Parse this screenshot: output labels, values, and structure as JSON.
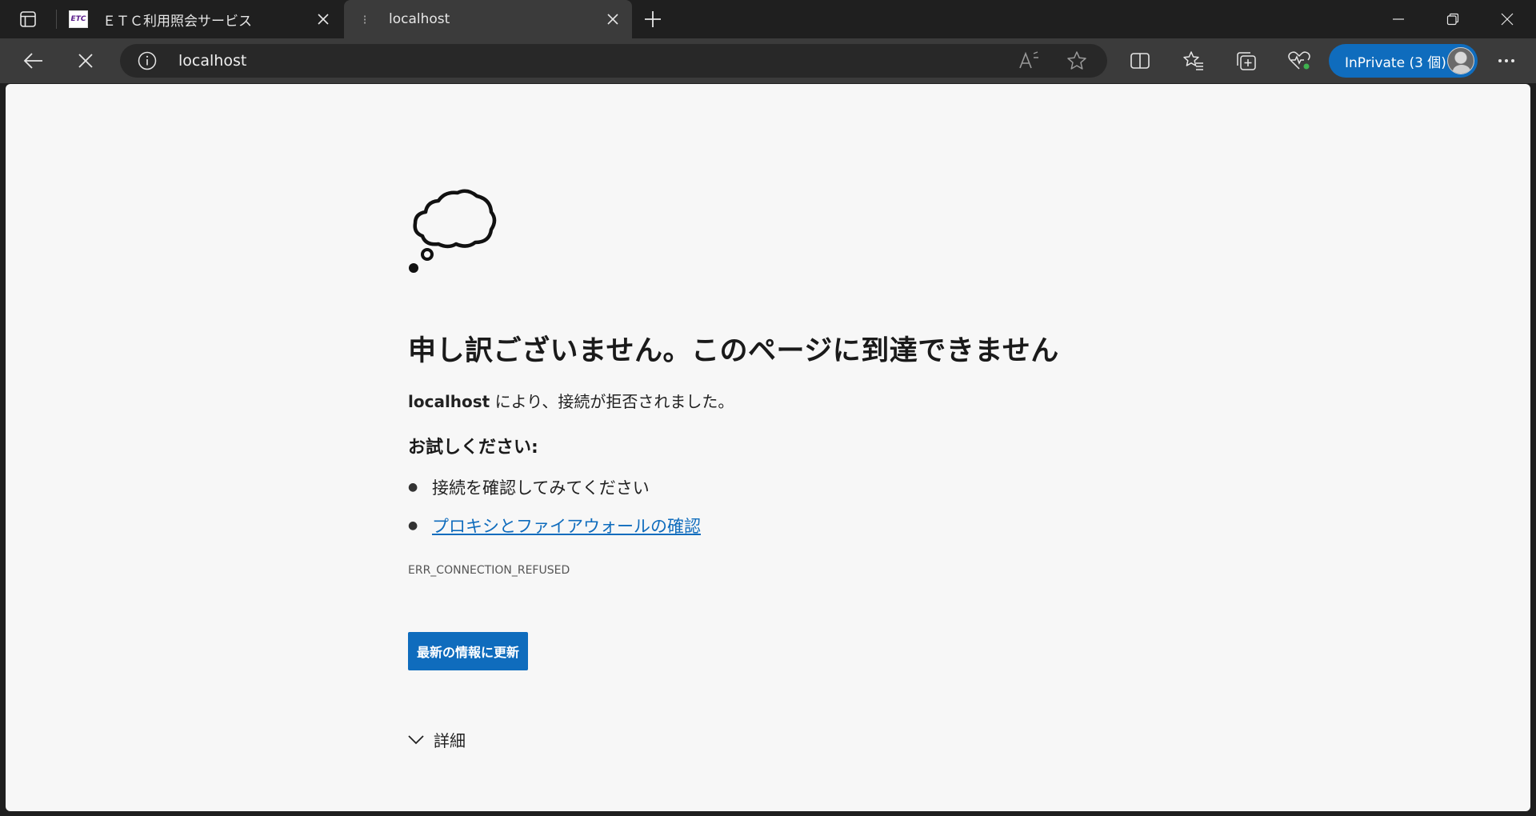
{
  "tabs": [
    {
      "title": "ＥＴＣ利用照会サービス",
      "favicon_text": "ETC",
      "active": false
    },
    {
      "title": "localhost",
      "active": true
    }
  ],
  "address_bar": {
    "url": "localhost"
  },
  "profile": {
    "label": "InPrivate (3 個)"
  },
  "error_page": {
    "heading": "申し訳ございません。このページに到達できません",
    "host": "localhost",
    "message_suffix": " により、接続が拒否されました。",
    "try_title": "お試しください:",
    "tips": [
      "接続を確認してみてください",
      "プロキシとファイアウォールの確認"
    ],
    "error_code": "ERR_CONNECTION_REFUSED",
    "refresh_label": "最新の情報に更新",
    "details_label": "詳細"
  },
  "colors": {
    "accent": "#0f6cbd",
    "page_bg": "#f7f7f7",
    "chrome_dark": "#1f1f1f",
    "toolbar": "#3b3b3b"
  },
  "icons": [
    "tab-actions-icon",
    "close-icon",
    "new-tab-icon",
    "minimize-icon",
    "restore-icon",
    "back-icon",
    "stop-icon",
    "info-icon",
    "read-aloud-icon",
    "favorite-star-icon",
    "split-screen-icon",
    "favorites-icon",
    "collections-icon",
    "browser-essentials-icon",
    "more-icon",
    "thought-cloud-icon",
    "chevron-down-icon"
  ]
}
